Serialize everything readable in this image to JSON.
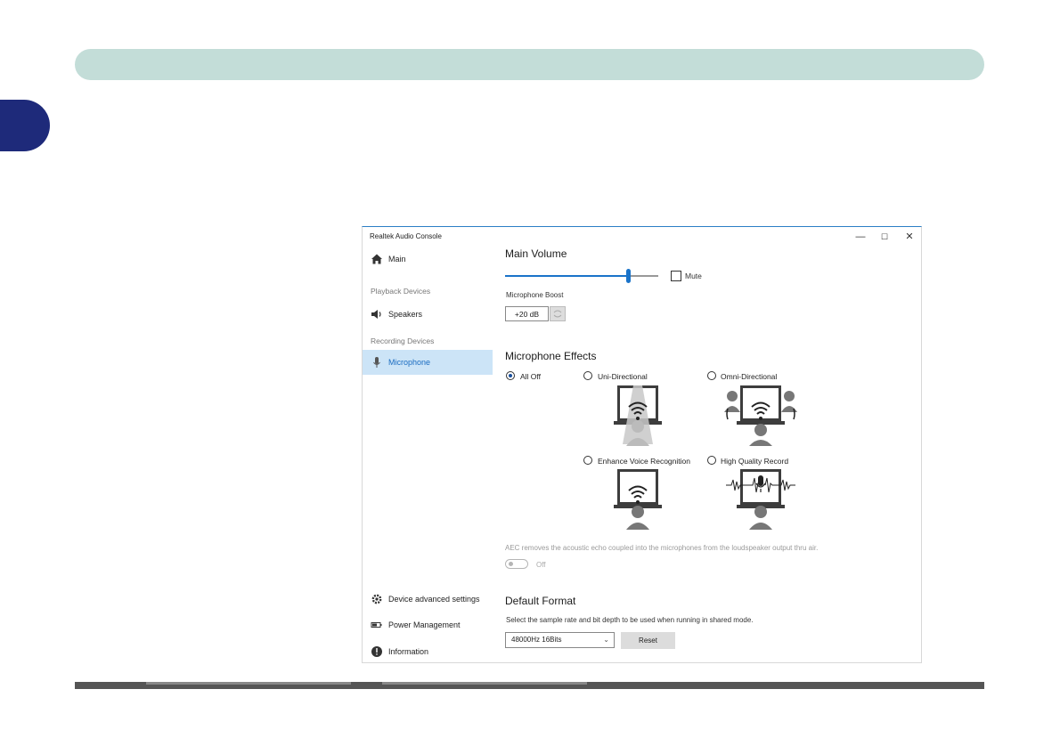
{
  "app": {
    "title": "Realtek Audio Console"
  },
  "window_controls": {
    "minimize": "—",
    "maximize": "☐",
    "close": "✕"
  },
  "nav": {
    "main": "Main",
    "playback_section": "Playback Devices",
    "speakers": "Speakers",
    "recording_section": "Recording Devices",
    "microphone": "Microphone",
    "device_advanced": "Device advanced settings",
    "power_management": "Power Management",
    "information": "Information"
  },
  "main_volume": {
    "heading": "Main Volume",
    "level": 0.8,
    "mute_label": "Mute",
    "muted": false
  },
  "boost": {
    "label": "Microphone Boost",
    "value": "+20 dB"
  },
  "effects": {
    "heading": "Microphone Effects",
    "options": [
      {
        "label": "All Off",
        "selected": true
      },
      {
        "label": "Uni-Directional",
        "selected": false
      },
      {
        "label": "Omni-Directional",
        "selected": false
      },
      {
        "label": "Enhance Voice Recognition",
        "selected": false
      },
      {
        "label": "High Quality Record",
        "selected": false
      }
    ]
  },
  "aec": {
    "text": "AEC removes the acoustic echo coupled into the microphones from the loudspeaker output thru air.",
    "toggle_label": "Off",
    "enabled": false
  },
  "default_format": {
    "heading": "Default Format",
    "description": "Select the sample rate and bit depth to be used when running in shared mode.",
    "selected": "48000Hz 16Bits",
    "reset_label": "Reset"
  },
  "colors": {
    "accent": "#1a73c9",
    "top_bar": "#c3ddd8",
    "side_tab": "#1e2a7a",
    "selected_nav": "#cce4f7"
  }
}
